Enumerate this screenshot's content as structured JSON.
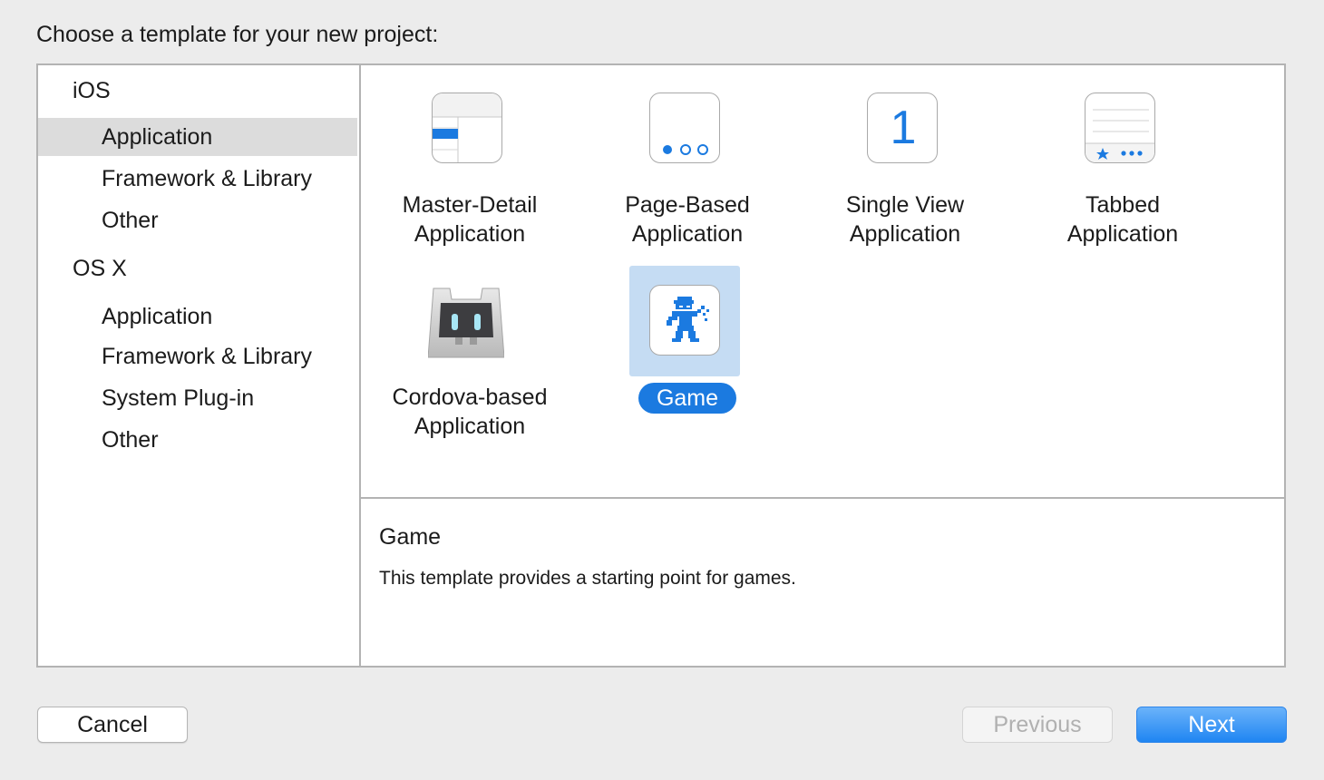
{
  "dialog": {
    "prompt": "Choose a template for your new project:"
  },
  "sidebar": {
    "groups": [
      {
        "title": "iOS",
        "items": [
          "Application",
          "Framework & Library",
          "Other"
        ]
      },
      {
        "title": "OS X",
        "items": [
          "Application",
          "Framework & Library",
          "System Plug-in",
          "Other"
        ]
      }
    ],
    "selected_group": "iOS",
    "selected_item": "Application"
  },
  "templates": [
    {
      "name": "Master-Detail\nApplication",
      "icon": "master-detail-icon",
      "line1": "Master-Detail",
      "line2": "Application"
    },
    {
      "name": "Page-Based Application",
      "icon": "page-based-icon",
      "line1": "Page-Based",
      "line2": "Application"
    },
    {
      "name": "Single View Application",
      "icon": "single-view-icon",
      "line1": "Single View",
      "line2": "Application",
      "glyph": "1"
    },
    {
      "name": "Tabbed Application",
      "icon": "tabbed-icon",
      "line1": "Tabbed",
      "line2": "Application"
    },
    {
      "name": "Cordova-based Application",
      "icon": "cordova-icon",
      "line1": "Cordova-based",
      "line2": "Application"
    },
    {
      "name": "Game",
      "icon": "game-icon",
      "line1": "Game",
      "selected": true
    }
  ],
  "description": {
    "title": "Game",
    "text": "This template provides a starting point for games."
  },
  "buttons": {
    "cancel": "Cancel",
    "previous": "Previous",
    "next": "Next"
  },
  "colors": {
    "accent": "#1b7ae0",
    "selection_bg": "#c5dcf3",
    "sidebar_selection": "#dcdcdc",
    "window_bg": "#ececec"
  }
}
